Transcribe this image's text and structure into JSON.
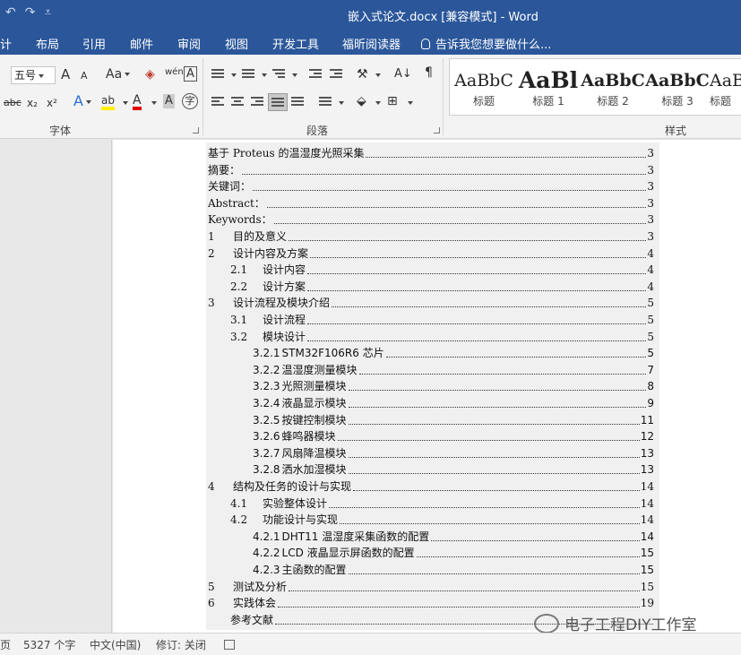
{
  "titlebar": {
    "title": "嵌入式论文.docx [兼容模式] - Word",
    "undo": "↶",
    "redo": "↷",
    "customize": "⩡"
  },
  "tabs": [
    "计",
    "布局",
    "引用",
    "邮件",
    "审阅",
    "视图",
    "开发工具",
    "福昕阅读器"
  ],
  "tellme": "告诉我您想要做什么...",
  "ribbon": {
    "font_size": "五号",
    "grow": "A",
    "shrink": "A",
    "change_case": "Aa",
    "phonetic": "wén",
    "border_char": "A",
    "strike": "abc",
    "subscript": "x₂",
    "superscript": "x²",
    "text_effect": "A",
    "highlight": "ab",
    "font_color": "A",
    "shading_char": "A",
    "enclose_char": "字",
    "sort": "A↓",
    "font_group": "字体",
    "paragraph_group": "段落",
    "styles_group": "样式",
    "styles": [
      {
        "sample": "AaBbC",
        "name": "标题"
      },
      {
        "sample": "AaBl",
        "name": "标题 1"
      },
      {
        "sample": "AaBbC",
        "name": "标题 2"
      },
      {
        "sample": "AaBbC",
        "name": "标题 3"
      },
      {
        "sample": "AaB",
        "name": "标题"
      }
    ]
  },
  "toc": [
    {
      "num": "",
      "text": "基于 Proteus 的温湿度光照采集",
      "page": "3",
      "level": 0
    },
    {
      "num": "",
      "text": "摘要：",
      "page": "3",
      "level": 0
    },
    {
      "num": "",
      "text": "关键词：",
      "page": "3",
      "level": 0
    },
    {
      "num": "",
      "text": "Abstract：",
      "page": "3",
      "level": 0
    },
    {
      "num": "",
      "text": "Keywords：",
      "page": "3",
      "level": 0
    },
    {
      "num": "1",
      "text": "目的及意义",
      "page": "3",
      "level": 1
    },
    {
      "num": "2",
      "text": "设计内容及方案",
      "page": "4",
      "level": 1
    },
    {
      "num": "2.1",
      "text": "设计内容",
      "page": "4",
      "level": 2
    },
    {
      "num": "2.2",
      "text": "设计方案",
      "page": "4",
      "level": 2
    },
    {
      "num": "3",
      "text": "设计流程及模块介绍",
      "page": "5",
      "level": 1
    },
    {
      "num": "3.1",
      "text": "设计流程",
      "page": "5",
      "level": 2
    },
    {
      "num": "3.2",
      "text": "模块设计",
      "page": "5",
      "level": 2
    },
    {
      "num": "3.2.1",
      "text": "STM32F106R6 芯片",
      "page": "5",
      "level": 3
    },
    {
      "num": "3.2.2",
      "text": "温湿度测量模块",
      "page": "7",
      "level": 3
    },
    {
      "num": "3.2.3",
      "text": "光照测量模块",
      "page": "8",
      "level": 3
    },
    {
      "num": "3.2.4",
      "text": "液晶显示模块",
      "page": "9",
      "level": 3
    },
    {
      "num": "3.2.5",
      "text": "按键控制模块",
      "page": "11",
      "level": 3
    },
    {
      "num": "3.2.6",
      "text": "蜂鸣器模块",
      "page": "12",
      "level": 3
    },
    {
      "num": "3.2.7",
      "text": "风扇降温模块",
      "page": "13",
      "level": 3
    },
    {
      "num": "3.2.8",
      "text": "洒水加湿模块",
      "page": "13",
      "level": 3
    },
    {
      "num": "4",
      "text": "结构及任务的设计与实现",
      "page": "14",
      "level": 1
    },
    {
      "num": "4.1",
      "text": "实验整体设计",
      "page": "14",
      "level": 2
    },
    {
      "num": "4.2",
      "text": "功能设计与实现",
      "page": "14",
      "level": 2
    },
    {
      "num": "4.2.1",
      "text": "DHT11 温湿度采集函数的配置",
      "page": "14",
      "level": 3
    },
    {
      "num": "4.2.2",
      "text": "LCD 液晶显示屏函数的配置",
      "page": "15",
      "level": 3
    },
    {
      "num": "4.2.3",
      "text": "主函数的配置",
      "page": "15",
      "level": 3
    },
    {
      "num": "5",
      "text": "测试及分析",
      "page": "15",
      "level": 1
    },
    {
      "num": "6",
      "text": "实践体会",
      "page": "19",
      "level": 1
    },
    {
      "num": "",
      "text": "参考文献",
      "page": "",
      "level": 2
    }
  ],
  "status": {
    "page": "页",
    "words": "5327 个字",
    "language": "中文(中国)",
    "track_changes": "修订: 关闭"
  },
  "watermark": "电子工程DIY工作室"
}
